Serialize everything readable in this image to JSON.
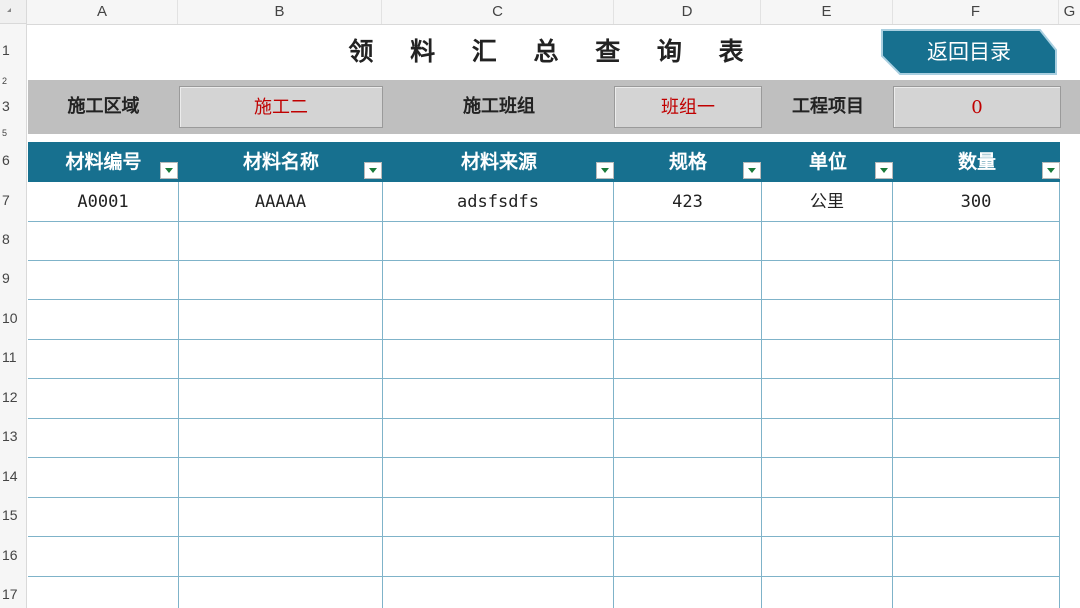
{
  "columns": [
    "A",
    "B",
    "C",
    "D",
    "E",
    "F",
    "G"
  ],
  "rows": [
    "1",
    "2",
    "3",
    "5",
    "6",
    "7",
    "8",
    "9",
    "10",
    "11",
    "12",
    "13",
    "14",
    "15",
    "16",
    "17"
  ],
  "title": "领 料 汇 总 查 询 表",
  "back_button": "返回目录",
  "filters": [
    {
      "label": "施工区域",
      "value": "施工二"
    },
    {
      "label": "施工班组",
      "value": "班组一"
    },
    {
      "label": "工程项目",
      "value": "0"
    }
  ],
  "table": {
    "headers": [
      "材料编号",
      "材料名称",
      "材料来源",
      "规格",
      "单位",
      "数量"
    ],
    "rows": [
      [
        "A0001",
        "AAAAA",
        "adsfsdfs",
        "423",
        "公里",
        "300"
      ]
    ]
  },
  "colors": {
    "header_bg": "#17708f",
    "filter_band": "#bfbfbf",
    "value_text": "#c00000",
    "grid_line": "#7fb3c9"
  }
}
